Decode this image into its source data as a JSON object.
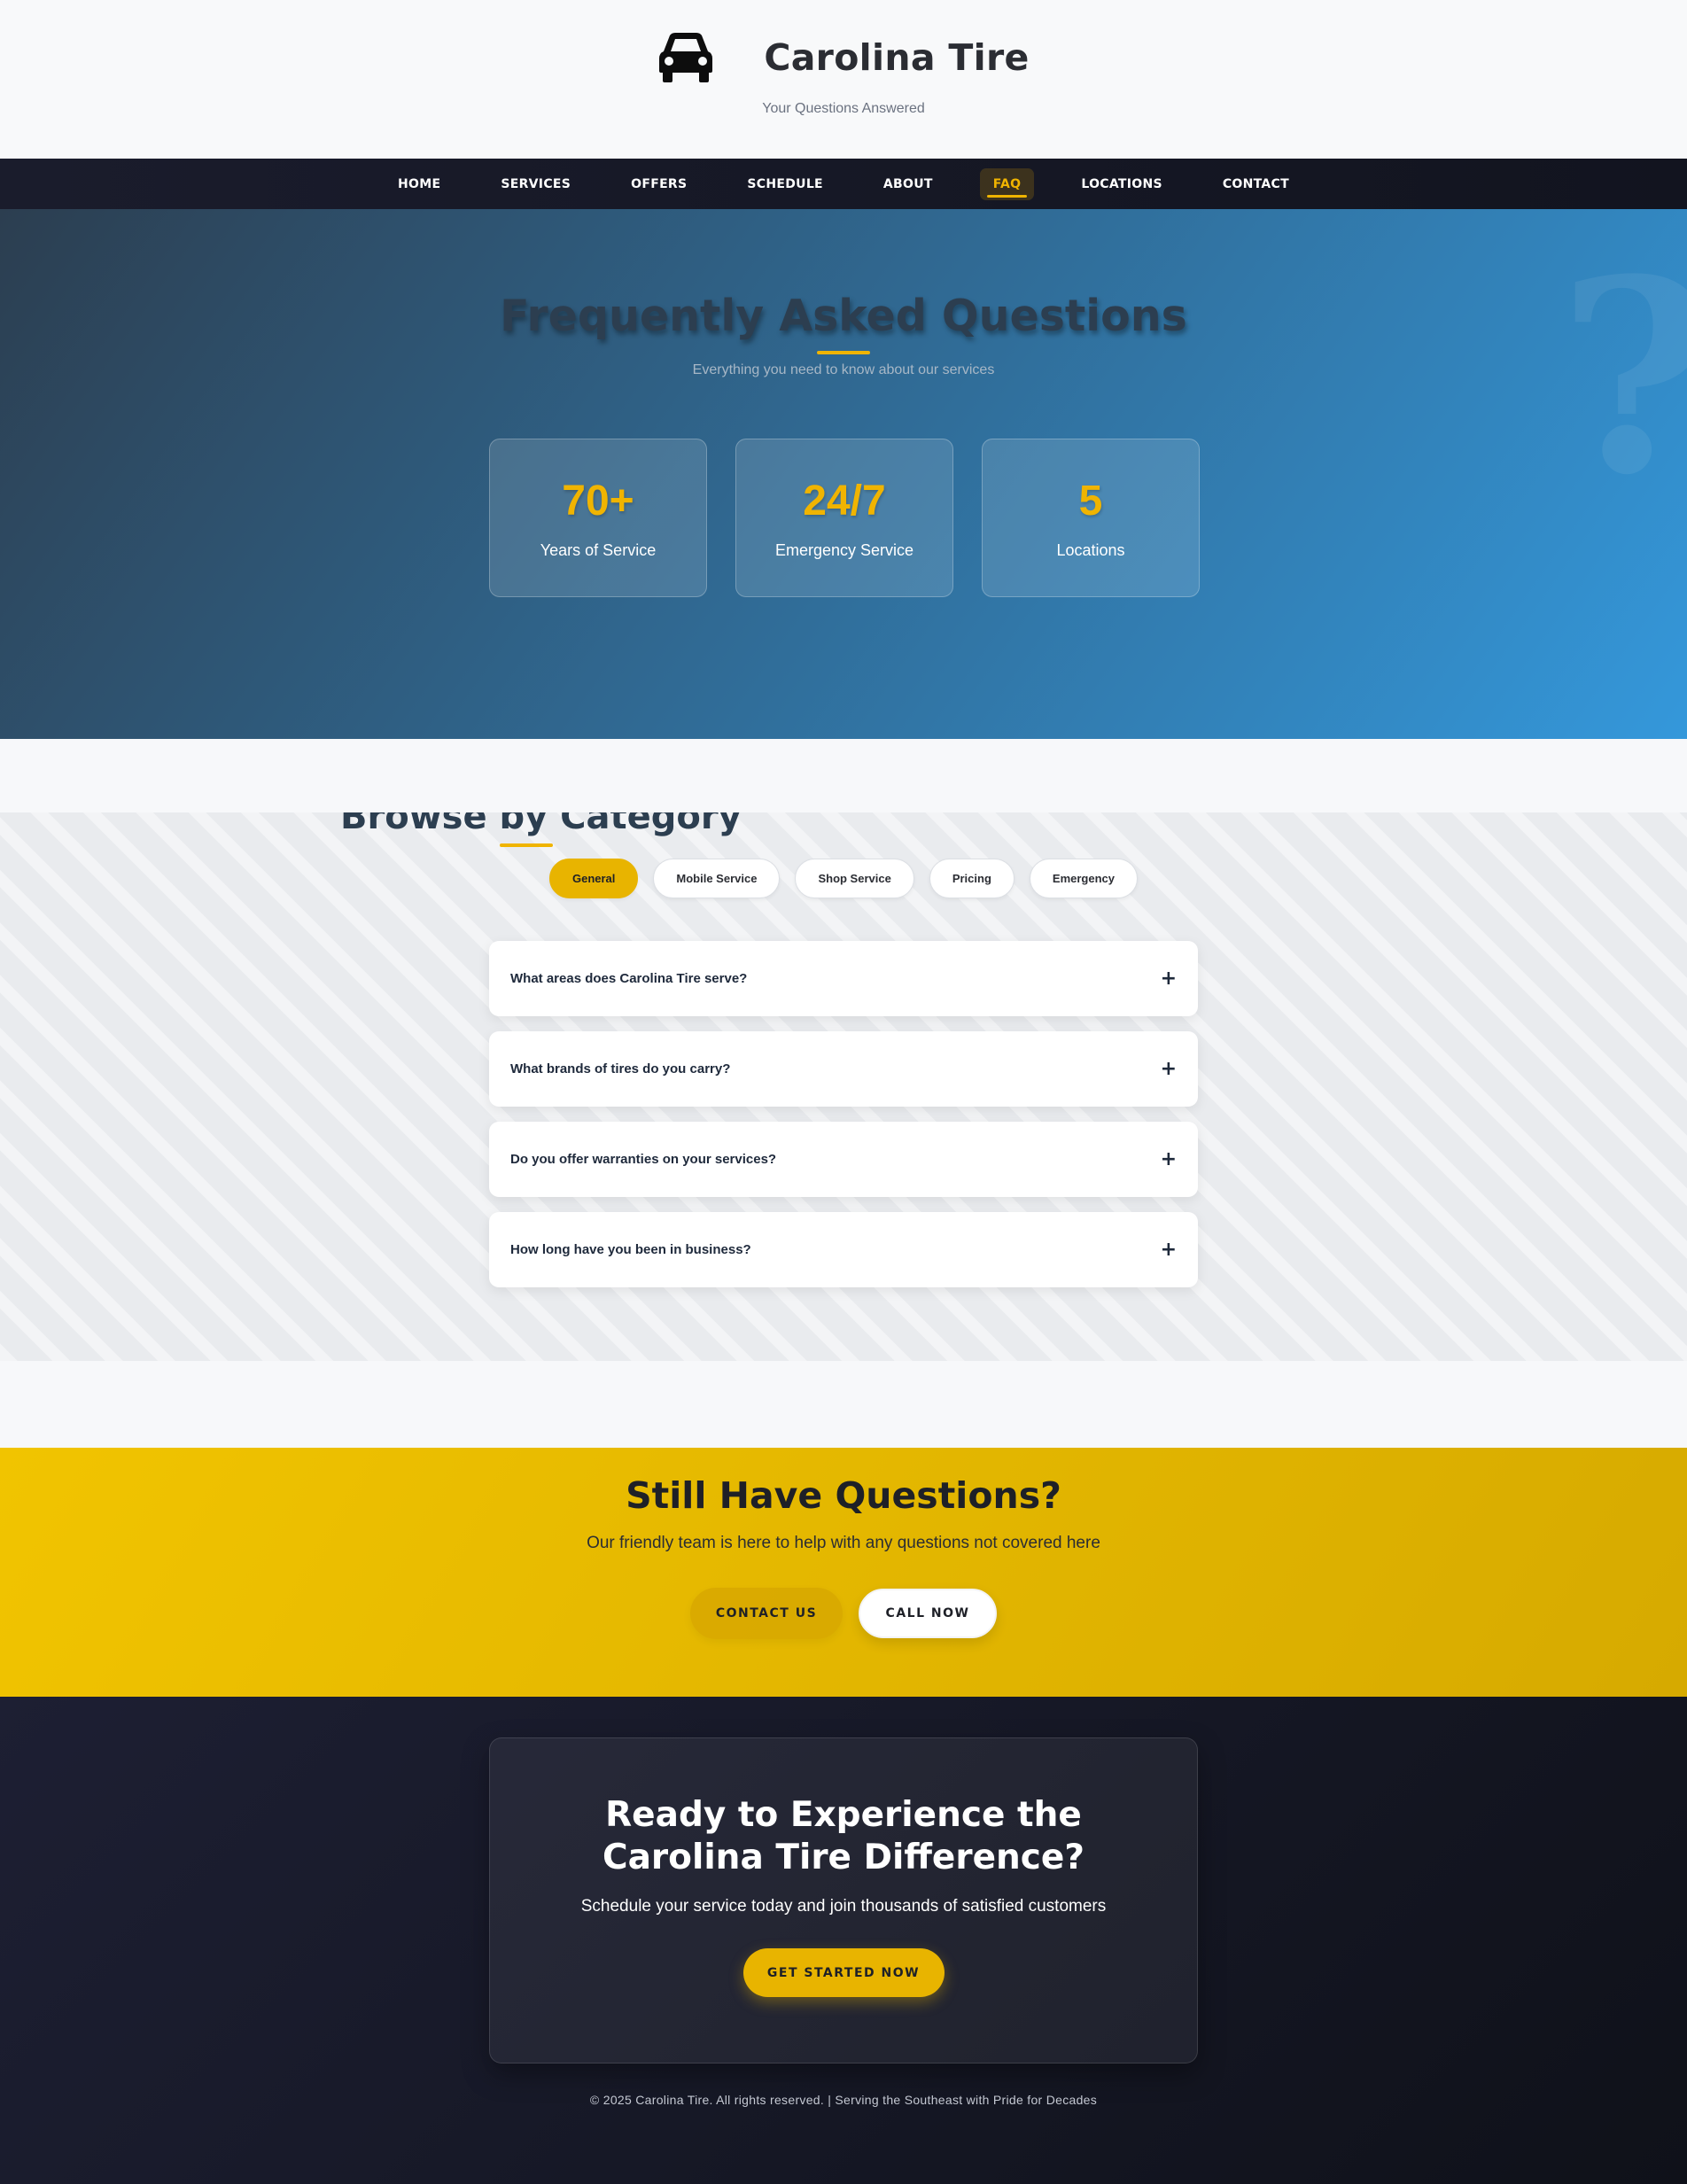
{
  "header": {
    "logo_icon": "car-icon",
    "title": "Carolina Tire",
    "tagline": "Your Questions Answered"
  },
  "nav": {
    "items": [
      "HOME",
      "SERVICES",
      "OFFERS",
      "SCHEDULE",
      "ABOUT",
      "FAQ",
      "LOCATIONS",
      "CONTACT"
    ],
    "active": "FAQ"
  },
  "hero": {
    "title": "Frequently Asked Questions",
    "subtitle": "Everything you need to know about our services",
    "decoration_icon": "question-mark-icon",
    "stats": [
      {
        "number": "70+",
        "label": "Years of Service"
      },
      {
        "number": "24/7",
        "label": "Emergency Service"
      },
      {
        "number": "5",
        "label": "Locations"
      }
    ]
  },
  "categories": {
    "title": "Browse by Category",
    "tabs": [
      "General",
      "Mobile Service",
      "Shop Service",
      "Pricing",
      "Emergency"
    ],
    "active_tab": "General",
    "faqs": [
      {
        "question": "What areas does Carolina Tire serve?",
        "toggle": "+"
      },
      {
        "question": "What brands of tires do you carry?",
        "toggle": "+"
      },
      {
        "question": "Do you offer warranties on your services?",
        "toggle": "+"
      },
      {
        "question": "How long have you been in business?",
        "toggle": "+"
      }
    ]
  },
  "cta": {
    "title": "Still Have Questions?",
    "text": "Our friendly team is here to help with any questions not covered here",
    "contact_label": "CONTACT US",
    "call_label": "CALL NOW"
  },
  "footer": {
    "card_title": "Ready to Experience the Carolina Tire Difference?",
    "card_text": "Schedule your service today and join thousands of satisfied customers",
    "button_label": "GET STARTED NOW",
    "copyright": "© 2025 Carolina Tire. All rights reserved. | Serving the Southeast with Pride for Decades"
  },
  "colors": {
    "accent": "#f0b400",
    "nav_bg": "#1a1c2c",
    "hero_start": "#2c3e50",
    "hero_end": "#3498db",
    "footer_bg": "#15172a"
  }
}
